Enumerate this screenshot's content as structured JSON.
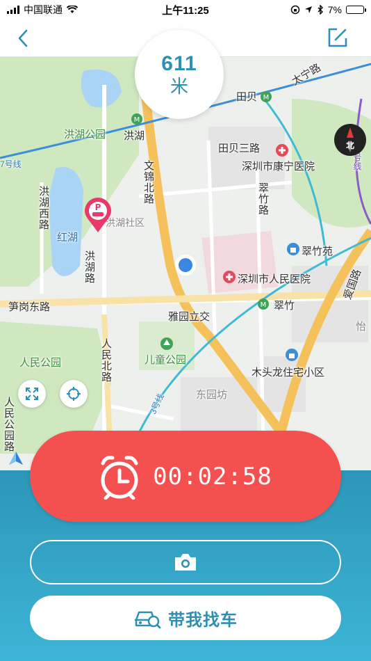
{
  "status_bar": {
    "carrier": "中国联通",
    "time": "上午11:25",
    "battery": "7%"
  },
  "nav": {
    "back_icon": "chevron-left-icon",
    "edit_icon": "edit-square-icon"
  },
  "distance": {
    "value": "611",
    "unit": "米"
  },
  "map": {
    "compass_label": "北",
    "labels": {
      "honghu_park": "洪湖公园",
      "honghu": "洪湖",
      "honghu_west_rd": "洪湖西路",
      "honghu_lake": "红湖",
      "honghu_rd": "洪湖路",
      "honghu_community": "洪湖社区",
      "wenjin_north_rd": "文锦北路",
      "tianbei": "田贝",
      "tianbei_3rd_rd": "田贝三路",
      "taining_rd": "太宁路",
      "kangning_hospital": "深圳市康宁医院",
      "cuizhu_rd": "翠竹路",
      "cuizhu_yuan": "翠竹苑",
      "people_hospital": "深圳市人民医院",
      "cuizhu": "翠竹",
      "aiguo_rd": "爱国路",
      "sungang_east_rd": "笋岗东路",
      "yayuan_interchange": "雅园立交",
      "children_park": "儿童公园",
      "people_park": "人民公园",
      "people_north_rd": "人民北路",
      "dongyuanfang": "东园坊",
      "mutoulong": "木头龙住宅小区",
      "people_park_rd": "人民公园路",
      "line_7": "7号线",
      "line_5": "5号线",
      "line_3": "3号线",
      "yi": "怡"
    }
  },
  "timer": {
    "icon": "alarm-clock-icon",
    "value": "00:02:58"
  },
  "camera_button": {
    "icon": "camera-icon"
  },
  "find_car_button": {
    "icon": "car-search-icon",
    "label": "带我找车"
  },
  "colors": {
    "accent_blue": "#2e8fb4",
    "timer_red": "#f55050",
    "panel_gradient_top": "#2c96b8",
    "panel_gradient_bottom": "#3db5d6",
    "parking_marker": "#e8396a",
    "location_dot": "#3b86e0"
  }
}
